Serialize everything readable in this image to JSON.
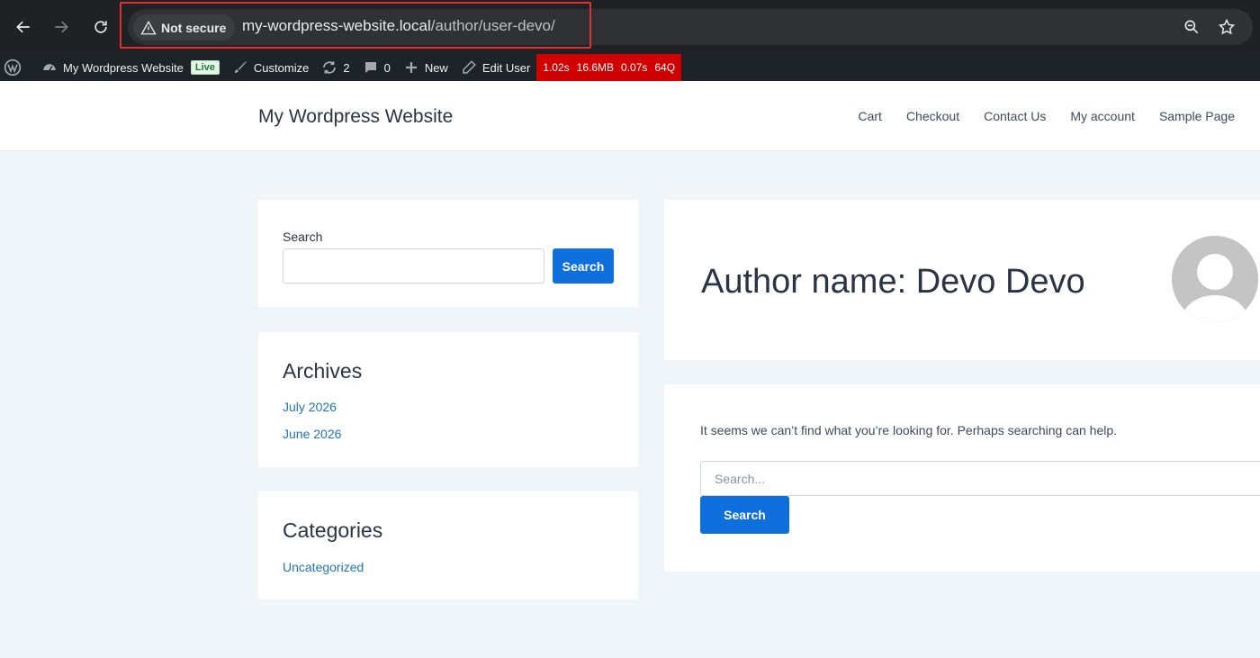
{
  "browser": {
    "security_label": "Not secure",
    "url_host": "my-wordpress-website.local",
    "url_path": "/author/user-devo/",
    "icons": [
      "back-icon",
      "forward-icon",
      "reload-icon",
      "warning-icon",
      "zoom-icon",
      "bookmark-star-icon"
    ]
  },
  "admin_bar": {
    "site_name": "My Wordpress Website",
    "live_badge": "Live",
    "customize": "Customize",
    "updates_count": "2",
    "comments_count": "0",
    "new_label": "New",
    "edit_user": "Edit User",
    "query_monitor": {
      "time": "1.02s",
      "memory": "16.6MB",
      "db_time": "0.07s",
      "queries": "64Q"
    }
  },
  "site": {
    "title": "My Wordpress Website",
    "nav": [
      "Cart",
      "Checkout",
      "Contact Us",
      "My account",
      "Sample Page"
    ]
  },
  "sidebar": {
    "search": {
      "label": "Search",
      "button": "Search"
    },
    "archives": {
      "title": "Archives",
      "items": [
        "July 2026",
        "June 2026"
      ]
    },
    "categories": {
      "title": "Categories",
      "items": [
        "Uncategorized"
      ]
    }
  },
  "main": {
    "author_title": "Author name: Devo Devo",
    "no_results": "It seems we can’t find what you’re looking for. Perhaps searching can help.",
    "search_placeholder": "Search...",
    "search_button": "Search"
  },
  "colors": {
    "accent": "#0f6fdc",
    "link": "#2176b8",
    "admin_bar": "#1d2327",
    "query_monitor": "#d00000",
    "highlight_box": "#e03131"
  }
}
